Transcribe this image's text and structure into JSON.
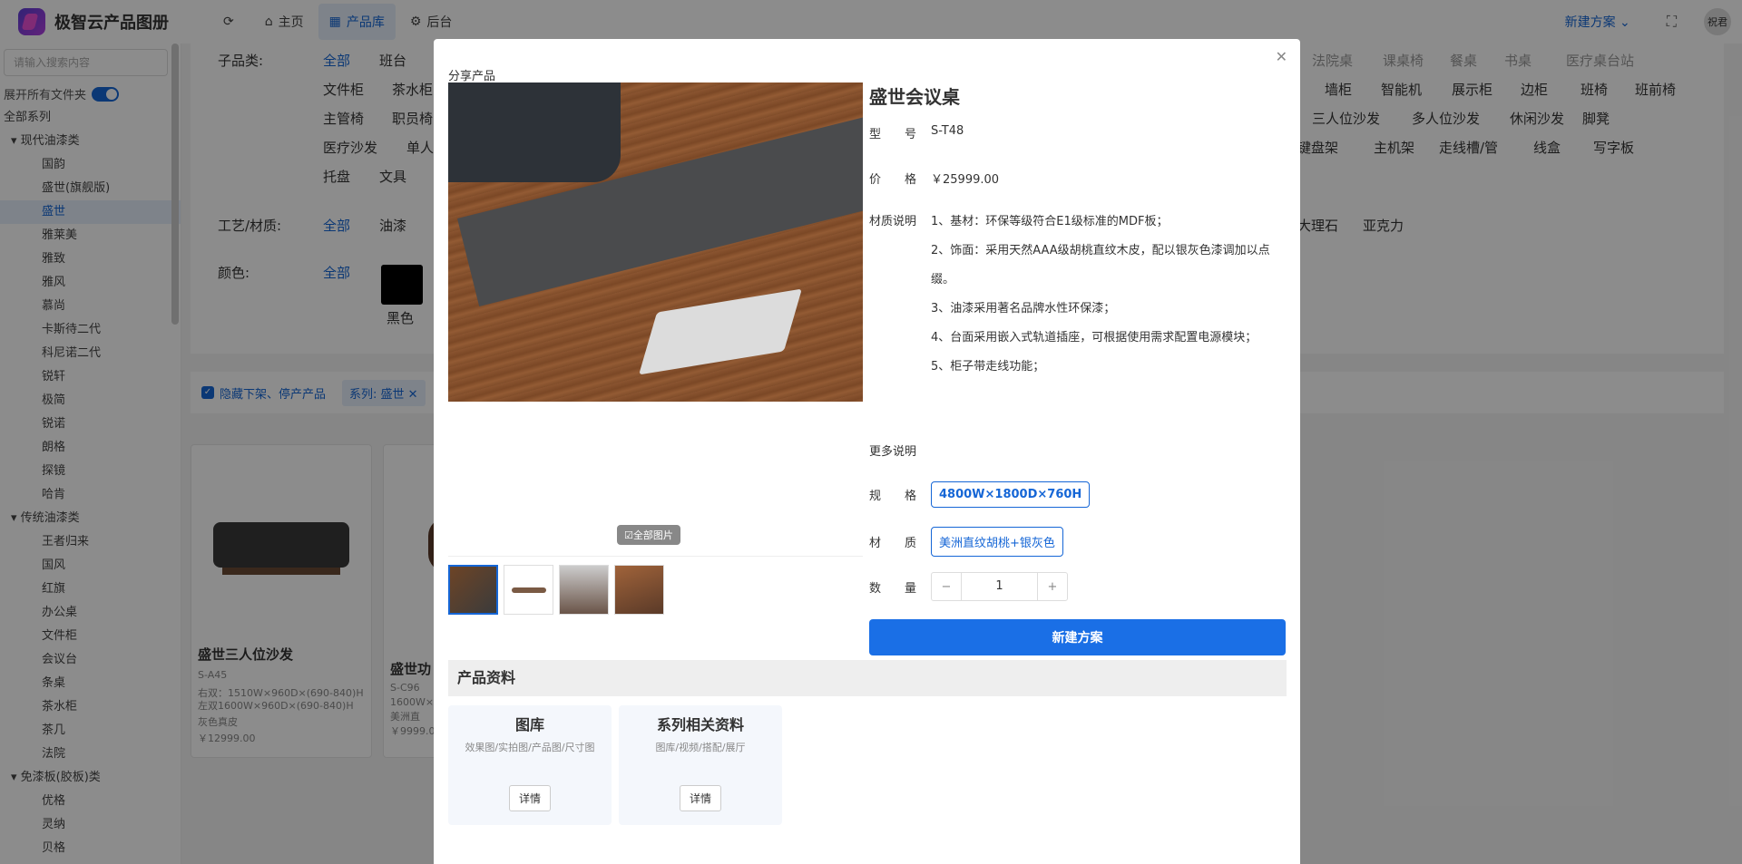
{
  "topbar": {
    "app_title": "极智云产品图册",
    "refresh_icon": "refresh-icon",
    "nav": [
      {
        "label": "主页",
        "icon": "home-icon"
      },
      {
        "label": "产品库",
        "icon": "grid-icon"
      },
      {
        "label": "后台",
        "icon": "gear-icon"
      }
    ],
    "new_plan": "新建方案",
    "user_name": "祝君"
  },
  "sidebar": {
    "search_placeholder": "请输入搜索内容",
    "expand_label": "展开所有文件夹",
    "tree": [
      {
        "label": "全部系列",
        "level": 0
      },
      {
        "label": "▾ 现代油漆类",
        "level": 1
      },
      {
        "label": "国韵",
        "level": 2
      },
      {
        "label": "盛世(旗舰版)",
        "level": 2
      },
      {
        "label": "盛世",
        "level": 2,
        "selected": true
      },
      {
        "label": "雅莱美",
        "level": 2
      },
      {
        "label": "雅致",
        "level": 2
      },
      {
        "label": "雅风",
        "level": 2
      },
      {
        "label": "慕尚",
        "level": 2
      },
      {
        "label": "卡斯待二代",
        "level": 2
      },
      {
        "label": "科尼诺二代",
        "level": 2
      },
      {
        "label": "锐轩",
        "level": 2
      },
      {
        "label": "极简",
        "level": 2
      },
      {
        "label": "锐诺",
        "level": 2
      },
      {
        "label": "朗格",
        "level": 2
      },
      {
        "label": "探镜",
        "level": 2
      },
      {
        "label": "哈肯",
        "level": 2
      },
      {
        "label": "▾ 传统油漆类",
        "level": 1
      },
      {
        "label": "王者归来",
        "level": 2
      },
      {
        "label": "国风",
        "level": 2
      },
      {
        "label": "红旗",
        "level": 2
      },
      {
        "label": "办公桌",
        "level": 2
      },
      {
        "label": "文件柜",
        "level": 2
      },
      {
        "label": "会议台",
        "level": 2
      },
      {
        "label": "条桌",
        "level": 2
      },
      {
        "label": "茶水柜",
        "level": 2
      },
      {
        "label": "茶几",
        "level": 2
      },
      {
        "label": "法院",
        "level": 2
      },
      {
        "label": "▾ 免漆板(胶板)类",
        "level": 1
      },
      {
        "label": "优格",
        "level": 2
      },
      {
        "label": "灵纳",
        "level": 2
      },
      {
        "label": "贝格",
        "level": 2
      }
    ]
  },
  "filters": {
    "sub_label": "子品类:",
    "sub_all": "全部",
    "sub_items": [
      "班台",
      "文件柜",
      "茶水柜",
      "主管椅",
      "职员椅",
      "医疗沙发",
      "单人",
      "托盘",
      "文具",
      "法院桌",
      "课桌椅",
      "餐桌",
      "书桌",
      "医疗桌台站",
      "墙柜",
      "智能机",
      "展示柜",
      "边柜",
      "班椅",
      "班前椅",
      "三人位沙发",
      "多人位沙发",
      "休闲沙发",
      "脚凳",
      "键盘架",
      "主机架",
      "走线槽/管",
      "线盒",
      "写字板"
    ],
    "craft_label": "工艺/材质:",
    "craft_all": "全部",
    "craft_items": [
      "油漆",
      "大理石",
      "亚克力"
    ],
    "color_label": "颜色:",
    "color_all": "全部",
    "color_name": "黑色",
    "hide_label": "隐藏下架、停产产品",
    "series_tag": "系列: 盛世 ✕"
  },
  "cards": [
    {
      "name": "盛世三人位沙发",
      "code": "S-A45",
      "spec1": "右双：1510W×960D×(690-840)H",
      "spec2": "左双1600W×960D×(690-840)H",
      "material": "灰色真皮",
      "price": "￥12999.00"
    },
    {
      "name": "盛世功",
      "code": "S-C96",
      "spec1": "1600W×",
      "spec2": "",
      "material": "美洲直",
      "price": "￥9999.0"
    }
  ],
  "modal": {
    "share": "分享产品",
    "title": "盛世会议桌",
    "model_label": "型　　号",
    "model": "S-T48",
    "price_label": "价　　格",
    "price": "￥25999.00",
    "material_desc_label": "材质说明",
    "desc": [
      "1、基材：环保等级符合E1级标准的MDF板；",
      "2、饰面：采用天然AAA级胡桃直纹木皮，配以银灰色漆调加以点缀。",
      "3、油漆采用著名品牌水性环保漆；",
      "4、台面采用嵌入式轨道插座，可根据使用需求配置电源模块；",
      "5、柜子带走线功能；"
    ],
    "more_label": "更多说明",
    "spec_label": "规　　格",
    "spec": "4800W×1800D×760H",
    "mat_label": "材　　质",
    "mat": "美洲直纹胡桃+银灰色",
    "qty_label": "数　　量",
    "qty": "1",
    "new_plan_btn": "新建方案",
    "all_pics": "☑全部图片",
    "section": "产品资料",
    "materials": [
      {
        "title": "图库",
        "sub": "效果图/实拍图/产品图/尺寸图",
        "btn": "详情"
      },
      {
        "title": "系列相关资料",
        "sub": "图库/视频/搭配/展厅",
        "btn": "详情"
      }
    ]
  }
}
